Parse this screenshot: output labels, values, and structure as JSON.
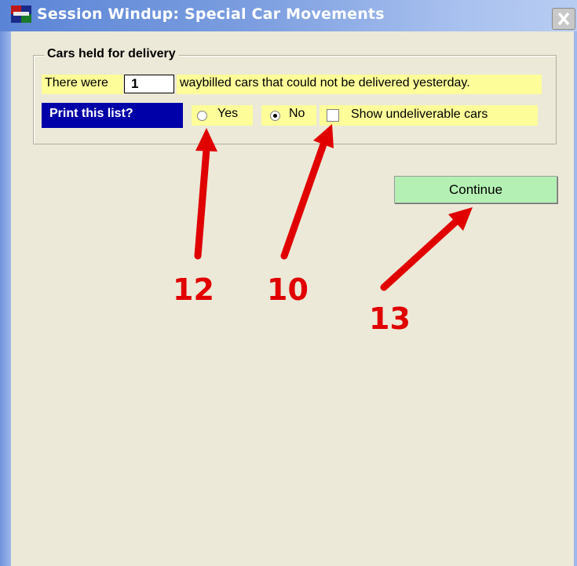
{
  "window": {
    "title": "Session Windup: Special Car Movements",
    "close_symbol": "✕"
  },
  "group": {
    "legend": "Cars held for delivery",
    "prefix": "There were",
    "count": "1",
    "suffix": "waybilled cars that could not be delivered yesterday.",
    "print_prompt": "Print this list?",
    "options": [
      {
        "label": "Yes",
        "selected": false
      },
      {
        "label": "No",
        "selected": true
      }
    ],
    "checkbox": {
      "label": "Show undeliverable cars",
      "checked": false
    }
  },
  "continue_label": "Continue",
  "annotations": [
    "12",
    "10",
    "13"
  ],
  "colors": {
    "highlight": "#fdfd9a",
    "prompt_bg": "#0000a8",
    "button_bg": "#b4f0b4",
    "annotation": "#e00000",
    "dialog_bg": "#ece9d8"
  }
}
